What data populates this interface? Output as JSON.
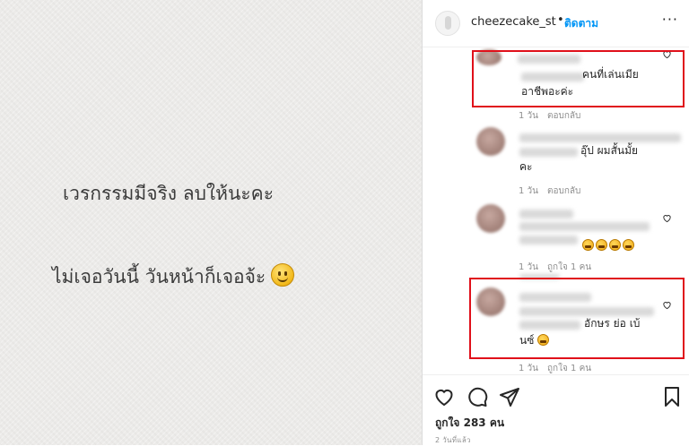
{
  "post": {
    "line1": "เวรกรรมมีจริง ลบให้นะคะ",
    "line2": "ไม่เจอวันนี้ วันหน้าก็เจอจ้ะ"
  },
  "header": {
    "username": "cheezecake_st",
    "separator": "•",
    "follow_label": "ติดตาม",
    "more_label": "···"
  },
  "comments": [
    {
      "text_line1": "คนที่เล่นเมีย",
      "text_line2": "อาชีพอะค่ะ",
      "age": "1 วัน",
      "reply": "ตอบกลับ",
      "highlighted": true
    },
    {
      "text_line1": "อุ๊ป ผมสั้นมั้ย",
      "text_line2": "คะ",
      "age": "1 วัน",
      "reply": "ตอบกลับ",
      "highlighted": false
    },
    {
      "emoji_count": 4,
      "age": "1 วัน",
      "likes": "ถูกใจ 1 คน",
      "highlighted": false
    },
    {
      "text_line1": "อักษร ย่อ เบ้",
      "text_line2": "นซ์",
      "age": "1 วัน",
      "likes": "ถูกใจ 1 คน",
      "highlighted": true
    }
  ],
  "footer": {
    "likes": "ถูกใจ 283 คน",
    "time": "2 วันที่แล้ว"
  },
  "colors": {
    "link": "#0095f6",
    "highlight": "#e0101a",
    "muted": "#8e8e8e"
  }
}
